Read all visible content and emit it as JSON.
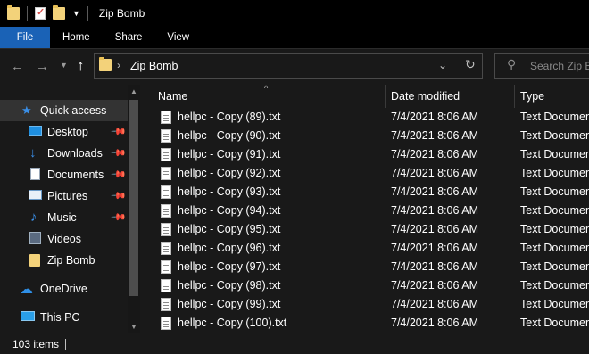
{
  "window": {
    "title": "Zip Bomb"
  },
  "ribbon": {
    "tabs": [
      "File",
      "Home",
      "Share",
      "View"
    ]
  },
  "address": {
    "path": "Zip Bomb",
    "search_placeholder": "Search Zip Bomb"
  },
  "nav": {
    "items": [
      {
        "label": "Quick access",
        "icon": "star-icon",
        "pinned": false,
        "selected": true
      },
      {
        "label": "Desktop",
        "icon": "desktop-icon",
        "pinned": true
      },
      {
        "label": "Downloads",
        "icon": "download-icon",
        "pinned": true
      },
      {
        "label": "Documents",
        "icon": "documents-icon",
        "pinned": true
      },
      {
        "label": "Pictures",
        "icon": "pictures-icon",
        "pinned": true
      },
      {
        "label": "Music",
        "icon": "music-icon",
        "pinned": true
      },
      {
        "label": "Videos",
        "icon": "videos-icon",
        "pinned": false
      },
      {
        "label": "Zip Bomb",
        "icon": "folder-icon",
        "pinned": false
      },
      {
        "label": "OneDrive",
        "icon": "cloud-icon",
        "pinned": false
      },
      {
        "label": "This PC",
        "icon": "computer-icon",
        "pinned": false
      }
    ]
  },
  "columns": {
    "name": "Name",
    "date": "Date modified",
    "type": "Type"
  },
  "files": [
    {
      "name": "hellpc - Copy (89).txt",
      "date": "7/4/2021 8:06 AM",
      "type": "Text Document"
    },
    {
      "name": "hellpc - Copy (90).txt",
      "date": "7/4/2021 8:06 AM",
      "type": "Text Document"
    },
    {
      "name": "hellpc - Copy (91).txt",
      "date": "7/4/2021 8:06 AM",
      "type": "Text Document"
    },
    {
      "name": "hellpc - Copy (92).txt",
      "date": "7/4/2021 8:06 AM",
      "type": "Text Document"
    },
    {
      "name": "hellpc - Copy (93).txt",
      "date": "7/4/2021 8:06 AM",
      "type": "Text Document"
    },
    {
      "name": "hellpc - Copy (94).txt",
      "date": "7/4/2021 8:06 AM",
      "type": "Text Document"
    },
    {
      "name": "hellpc - Copy (95).txt",
      "date": "7/4/2021 8:06 AM",
      "type": "Text Document"
    },
    {
      "name": "hellpc - Copy (96).txt",
      "date": "7/4/2021 8:06 AM",
      "type": "Text Document"
    },
    {
      "name": "hellpc - Copy (97).txt",
      "date": "7/4/2021 8:06 AM",
      "type": "Text Document"
    },
    {
      "name": "hellpc - Copy (98).txt",
      "date": "7/4/2021 8:06 AM",
      "type": "Text Document"
    },
    {
      "name": "hellpc - Copy (99).txt",
      "date": "7/4/2021 8:06 AM",
      "type": "Text Document"
    },
    {
      "name": "hellpc - Copy (100).txt",
      "date": "7/4/2021 8:06 AM",
      "type": "Text Document"
    }
  ],
  "status": {
    "item_count": "103 items"
  },
  "colors": {
    "file_tab": "#1a62b6",
    "background": "#191919",
    "selection": "#333333"
  }
}
